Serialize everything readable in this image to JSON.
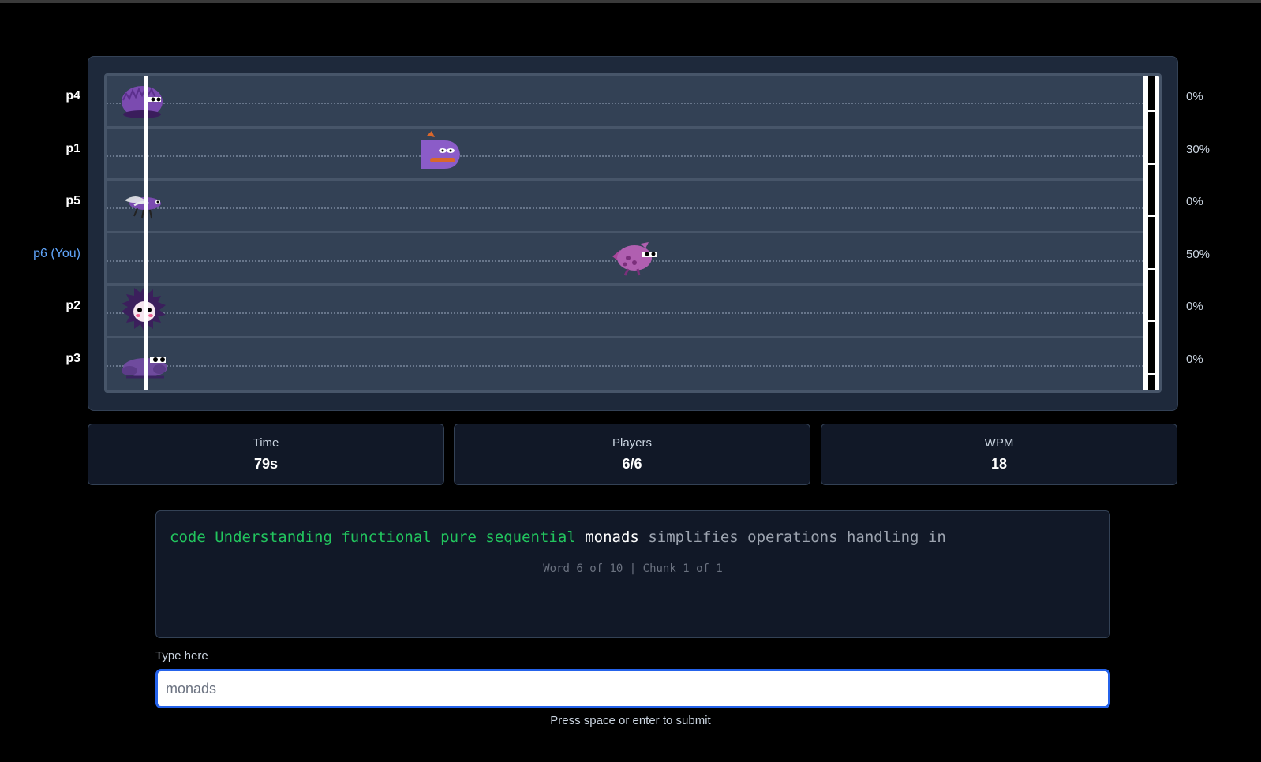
{
  "race": {
    "players": [
      {
        "name": "p4",
        "percent": "0%",
        "progress": 0,
        "racer": "hedgehog-racer",
        "you": false
      },
      {
        "name": "p1",
        "percent": "30%",
        "progress": 0.3,
        "racer": "fish-racer",
        "you": false
      },
      {
        "name": "p5",
        "percent": "0%",
        "progress": 0,
        "racer": "fly-racer",
        "you": false
      },
      {
        "name": "p6 (You)",
        "percent": "50%",
        "progress": 0.5,
        "racer": "pink-fish-racer",
        "you": true
      },
      {
        "name": "p2",
        "percent": "0%",
        "progress": 0,
        "racer": "urchin-racer",
        "you": false
      },
      {
        "name": "p3",
        "percent": "0%",
        "progress": 0,
        "racer": "crab-racer",
        "you": false
      }
    ]
  },
  "stats": {
    "time_label": "Time",
    "time_value": "79s",
    "players_label": "Players",
    "players_value": "6/6",
    "wpm_label": "WPM",
    "wpm_value": "18"
  },
  "passage": {
    "completed": "code Understanding functional pure sequential",
    "current": "monads",
    "remaining": "simplifies operations handling in",
    "progress_text": "Word 6 of 10 | Chunk 1 of 1"
  },
  "input": {
    "label": "Type here",
    "placeholder": "monads",
    "hint": "Press space or enter to submit"
  },
  "colors": {
    "completed": "#22c55e",
    "you": "#60a5fa",
    "input_border": "#2563eb",
    "racer_purple": "#8b5cc8"
  }
}
